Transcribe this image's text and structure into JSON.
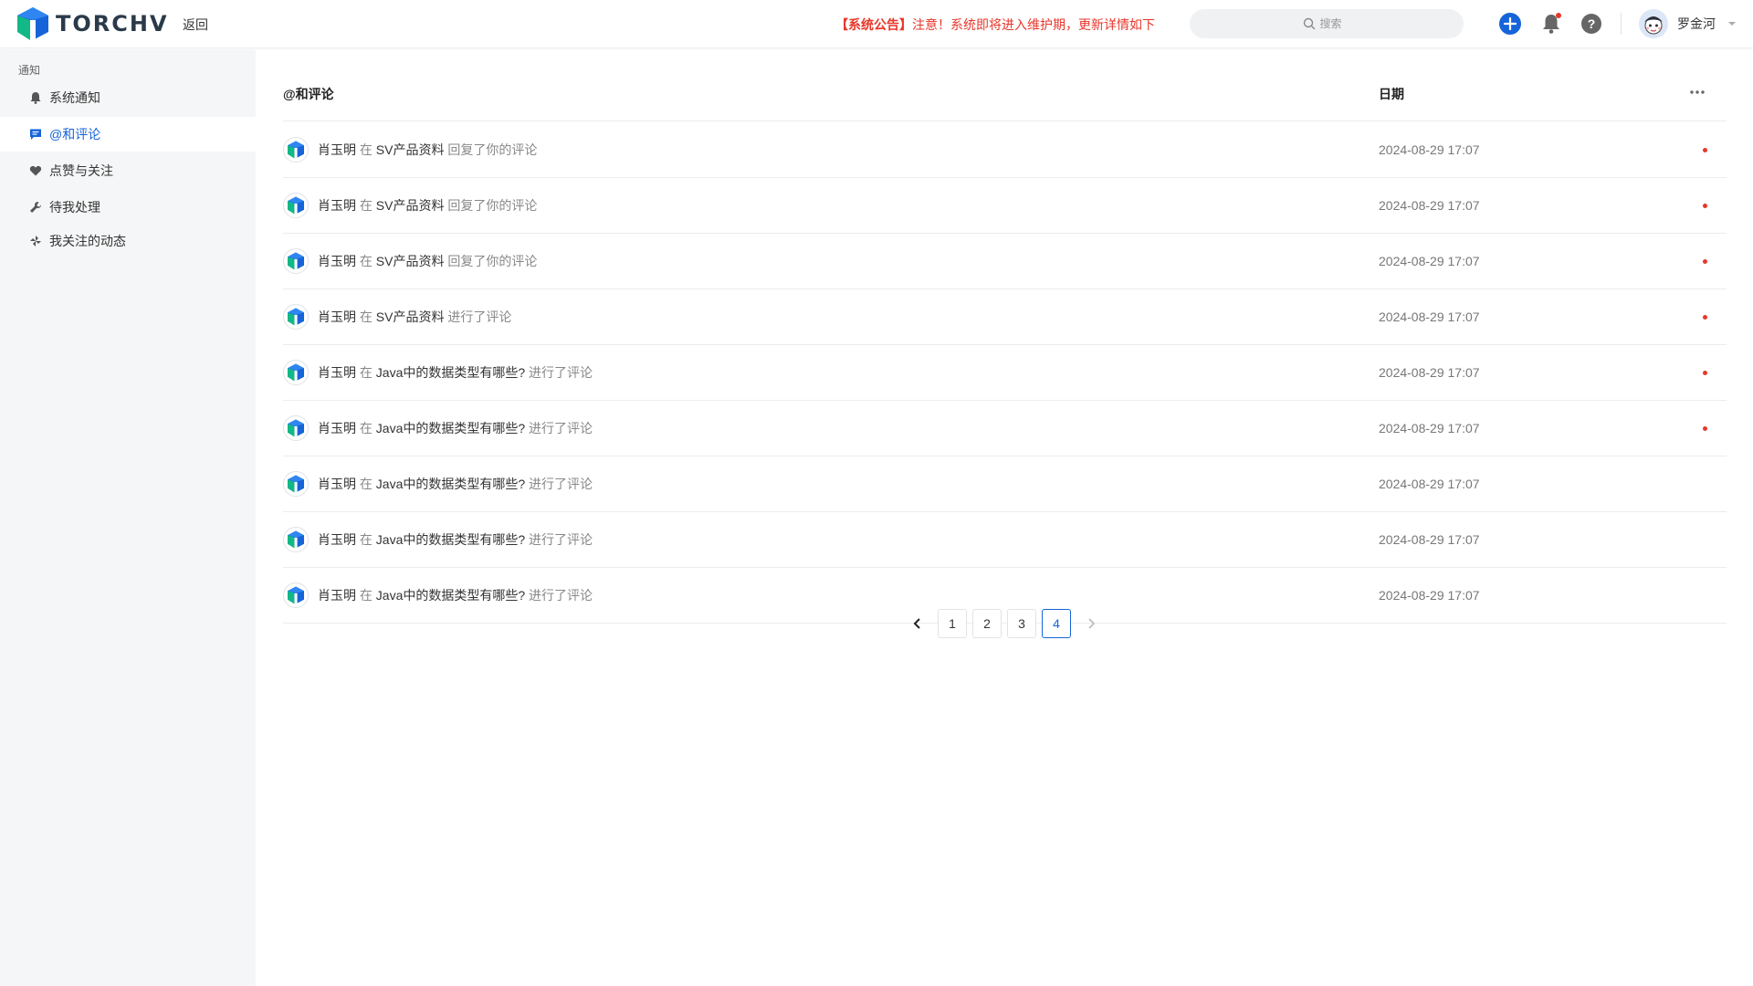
{
  "app": {
    "logo_text": "TORCHV",
    "back_label": "返回"
  },
  "announcement": {
    "tag": "【系统公告】",
    "text": "注意！系统即将进入维护期，更新详情如下"
  },
  "search": {
    "placeholder": "搜索"
  },
  "user": {
    "name": "罗金河"
  },
  "colors": {
    "accent": "#1664d9",
    "alert": "#e8362a",
    "sidebar_bg": "#f5f6f7"
  },
  "sidebar": {
    "section_title": "通知",
    "items": [
      {
        "label": "系统通知",
        "icon": "bell-icon",
        "active": false
      },
      {
        "label": "@和评论",
        "icon": "comment-icon",
        "active": true
      },
      {
        "label": "点赞与关注",
        "icon": "heart-icon",
        "active": false
      },
      {
        "label": "待我处理",
        "icon": "wrench-icon",
        "active": false
      },
      {
        "label": "我关注的动态",
        "icon": "pinwheel-icon",
        "active": false
      }
    ]
  },
  "list": {
    "title": "@和评论",
    "date_header": "日期",
    "rows": [
      {
        "user": "肖玉明",
        "prep": "在",
        "target": "SV产品资料",
        "action": "回复了你的评论",
        "date": "2024-08-29 17:07",
        "unread": true
      },
      {
        "user": "肖玉明",
        "prep": "在",
        "target": "SV产品资料",
        "action": "回复了你的评论",
        "date": "2024-08-29 17:07",
        "unread": true
      },
      {
        "user": "肖玉明",
        "prep": "在",
        "target": "SV产品资料",
        "action": "回复了你的评论",
        "date": "2024-08-29 17:07",
        "unread": true
      },
      {
        "user": "肖玉明",
        "prep": "在",
        "target": "SV产品资料",
        "action": "进行了评论",
        "date": "2024-08-29 17:07",
        "unread": true
      },
      {
        "user": "肖玉明",
        "prep": "在",
        "target": "Java中的数据类型有哪些?",
        "action": "进行了评论",
        "date": "2024-08-29 17:07",
        "unread": true
      },
      {
        "user": "肖玉明",
        "prep": "在",
        "target": "Java中的数据类型有哪些?",
        "action": "进行了评论",
        "date": "2024-08-29 17:07",
        "unread": true
      },
      {
        "user": "肖玉明",
        "prep": "在",
        "target": "Java中的数据类型有哪些?",
        "action": "进行了评论",
        "date": "2024-08-29 17:07",
        "unread": false
      },
      {
        "user": "肖玉明",
        "prep": "在",
        "target": "Java中的数据类型有哪些?",
        "action": "进行了评论",
        "date": "2024-08-29 17:07",
        "unread": false
      },
      {
        "user": "肖玉明",
        "prep": "在",
        "target": "Java中的数据类型有哪些?",
        "action": "进行了评论",
        "date": "2024-08-29 17:07",
        "unread": false
      }
    ]
  },
  "pagination": {
    "pages": [
      "1",
      "2",
      "3",
      "4"
    ],
    "current": "4"
  }
}
